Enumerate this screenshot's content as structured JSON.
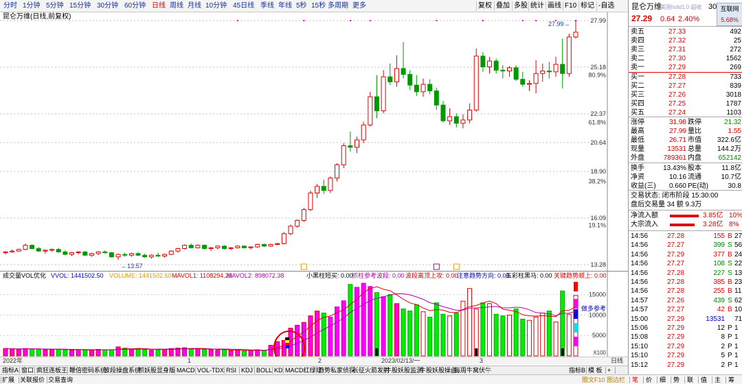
{
  "toolbar": {
    "periods": [
      "分时",
      "1分钟",
      "5分钟",
      "15分钟",
      "30分钟",
      "60分钟",
      "日线",
      "周线",
      "月线",
      "10分钟",
      "45日线",
      "季线",
      "年线",
      "5秒",
      "15秒",
      "多周期",
      "更多"
    ],
    "active": "日线",
    "right_tools": [
      "复权",
      "叠加",
      "多股",
      "统计",
      "画线",
      "F10",
      "标记",
      "-自选"
    ]
  },
  "chart_title": "昆仑万维(日线,前复权)",
  "chart_data": {
    "type": "candlestick",
    "dates_visible": [
      "2022年",
      "1",
      "2",
      "2023/02/13/一",
      "3"
    ],
    "ylim": [
      13.28,
      27.99
    ],
    "y_ticks": [
      27.99,
      25.18,
      22.37,
      20.64,
      18.9,
      16.09,
      13.28
    ],
    "y_pct_ticks": [
      {
        "price": 24.7,
        "label": "80.9%"
      },
      {
        "price": 21.85,
        "label": "61.8%"
      },
      {
        "price": 18.3,
        "label": "38.2%"
      },
      {
        "price": 15.65,
        "label": "19.1%"
      }
    ],
    "candles": [
      [
        14.0,
        14.1,
        13.9,
        14.05
      ],
      [
        14.05,
        14.2,
        14.0,
        14.1
      ],
      [
        14.1,
        14.25,
        14.05,
        14.2
      ],
      [
        14.2,
        14.55,
        14.15,
        14.45
      ],
      [
        14.45,
        14.5,
        14.2,
        14.25
      ],
      [
        14.25,
        14.35,
        14.05,
        14.1
      ],
      [
        14.1,
        14.2,
        13.95,
        14.15
      ],
      [
        14.15,
        14.25,
        14.05,
        14.2
      ],
      [
        14.2,
        14.3,
        14.0,
        14.05
      ],
      [
        14.05,
        14.15,
        13.85,
        13.9
      ],
      [
        13.9,
        14.05,
        13.8,
        14.0
      ],
      [
        14.0,
        14.1,
        13.9,
        14.05
      ],
      [
        14.05,
        14.1,
        13.8,
        13.85
      ],
      [
        13.85,
        14.0,
        13.75,
        13.95
      ],
      [
        13.95,
        14.1,
        13.85,
        14.05
      ],
      [
        14.05,
        14.15,
        13.95,
        14.0
      ],
      [
        14.0,
        14.05,
        13.7,
        13.75
      ],
      [
        13.75,
        13.95,
        13.57,
        13.9
      ],
      [
        13.9,
        14.0,
        13.75,
        13.85
      ],
      [
        13.85,
        14.0,
        13.75,
        13.95
      ],
      [
        13.95,
        14.05,
        13.8,
        13.85
      ],
      [
        13.85,
        13.95,
        13.7,
        13.75
      ],
      [
        13.75,
        13.9,
        13.65,
        13.85
      ],
      [
        13.85,
        14.0,
        13.75,
        13.8
      ],
      [
        13.8,
        13.95,
        13.7,
        13.9
      ],
      [
        13.9,
        14.15,
        13.85,
        14.1
      ],
      [
        14.1,
        14.3,
        14.0,
        14.25
      ],
      [
        14.25,
        14.5,
        14.2,
        14.45
      ],
      [
        14.45,
        14.55,
        14.25,
        14.3
      ],
      [
        14.3,
        14.5,
        14.25,
        14.45
      ],
      [
        14.45,
        14.5,
        14.2,
        14.25
      ],
      [
        14.25,
        14.35,
        14.1,
        14.3
      ],
      [
        14.3,
        14.45,
        14.2,
        14.4
      ],
      [
        14.4,
        14.45,
        14.2,
        14.25
      ],
      [
        14.25,
        14.35,
        14.15,
        14.3
      ],
      [
        14.3,
        14.45,
        14.25,
        14.4
      ],
      [
        14.4,
        14.45,
        14.25,
        14.3
      ],
      [
        14.3,
        14.4,
        14.2,
        14.35
      ],
      [
        14.35,
        14.55,
        14.3,
        14.5
      ],
      [
        14.5,
        14.55,
        14.35,
        14.4
      ],
      [
        14.4,
        14.55,
        14.35,
        14.5
      ],
      [
        14.5,
        14.6,
        14.45,
        14.55
      ],
      [
        14.55,
        15.25,
        14.5,
        15.15
      ],
      [
        15.15,
        15.7,
        15.05,
        15.6
      ],
      [
        15.6,
        16.0,
        15.5,
        15.95
      ],
      [
        15.95,
        16.7,
        15.85,
        16.6
      ],
      [
        16.6,
        17.75,
        16.5,
        17.6
      ],
      [
        17.6,
        18.15,
        17.3,
        18.0
      ],
      [
        18.0,
        18.4,
        17.55,
        17.75
      ],
      [
        17.75,
        18.6,
        17.6,
        18.5
      ],
      [
        18.5,
        19.4,
        18.3,
        19.3
      ],
      [
        19.3,
        20.6,
        19.1,
        20.45
      ],
      [
        20.45,
        21.3,
        20.1,
        20.35
      ],
      [
        20.35,
        21.0,
        20.0,
        20.8
      ],
      [
        20.8,
        21.9,
        20.6,
        21.7
      ],
      [
        21.7,
        23.7,
        21.6,
        23.4
      ],
      [
        23.4,
        24.7,
        22.1,
        22.55
      ],
      [
        22.55,
        25.0,
        22.4,
        24.6
      ],
      [
        24.6,
        25.4,
        24.1,
        24.3
      ],
      [
        24.3,
        25.9,
        24.0,
        25.1
      ],
      [
        25.1,
        26.7,
        24.5,
        24.75
      ],
      [
        24.75,
        25.0,
        23.8,
        24.1
      ],
      [
        24.1,
        24.7,
        23.45,
        23.7
      ],
      [
        23.7,
        24.5,
        23.4,
        24.15
      ],
      [
        24.15,
        24.45,
        23.55,
        23.75
      ],
      [
        23.75,
        23.95,
        22.6,
        22.9
      ],
      [
        22.9,
        23.15,
        21.85,
        21.95
      ],
      [
        21.95,
        22.7,
        21.7,
        22.2
      ],
      [
        22.2,
        22.4,
        21.55,
        21.8
      ],
      [
        21.8,
        22.35,
        21.5,
        22.0
      ],
      [
        22.0,
        23.0,
        21.8,
        22.6
      ],
      [
        22.6,
        26.3,
        22.5,
        25.85
      ],
      [
        25.85,
        26.1,
        24.9,
        25.2
      ],
      [
        25.2,
        25.8,
        24.8,
        25.55
      ],
      [
        25.55,
        25.7,
        24.8,
        25.0
      ],
      [
        25.0,
        25.3,
        24.5,
        24.95
      ],
      [
        24.95,
        25.25,
        24.6,
        25.15
      ],
      [
        25.15,
        25.3,
        24.35,
        24.45
      ],
      [
        24.45,
        24.9,
        24.0,
        24.15
      ],
      [
        24.15,
        24.4,
        23.75,
        24.2
      ],
      [
        24.2,
        25.6,
        23.6,
        24.8
      ],
      [
        24.8,
        25.4,
        24.3,
        24.95
      ],
      [
        24.95,
        25.5,
        24.5,
        24.9
      ],
      [
        24.9,
        25.8,
        24.6,
        25.35
      ],
      [
        25.35,
        26.9,
        23.9,
        24.8
      ],
      [
        24.8,
        27.2,
        24.6,
        27.0
      ],
      [
        27.0,
        27.99,
        26.9,
        27.29
      ]
    ],
    "annotations": [
      {
        "label": "13.57",
        "price": 13.57
      },
      {
        "label": "27.99",
        "price": 27.99
      }
    ],
    "volume": {
      "title": "成交量VOL优化",
      "labels": [
        {
          "text": "VVOL: 1441502.50",
          "color": "#0000cc"
        },
        {
          "text": "VOLUME: 1441502.50",
          "color": "#d4a000"
        },
        {
          "text": "MAVOL1: 1108294.25",
          "color": "#e00000"
        },
        {
          "text": "MAVOL2: 898072.38",
          "color": "#b000b0"
        },
        {
          "text": "小黑柱短买: 0.00",
          "color": "#000000"
        },
        {
          "text": "抓柱参考波段: 0.00",
          "color": "#b000b0"
        },
        {
          "text": "波段离顶上攻: 0.00",
          "color": "#e00000"
        },
        {
          "text": "注意趋势方向: 0.00",
          "color": "#0000cc"
        },
        {
          "text": "五彩柱黑马: 0.00",
          "color": "#000000"
        },
        {
          "text": "关键趋势顺上: 0.00",
          "color": "#e00000"
        }
      ],
      "y_ticks": [
        15000,
        10000,
        5000
      ],
      "ylim": [
        0,
        17800
      ],
      "unit_label": "X100",
      "tags": [
        "做多参考"
      ],
      "values": [
        1800,
        1700,
        1600,
        1800,
        1700,
        1650,
        1500,
        1550,
        1600,
        1500,
        1400,
        1500,
        1450,
        1400,
        1600,
        1500,
        1450,
        2200,
        1900,
        1700,
        1800,
        1500,
        1400,
        1500,
        1600,
        1800,
        1900,
        2000,
        1800,
        1700,
        1600,
        1500,
        1400,
        1500,
        1300,
        1400,
        1200,
        1300,
        1500,
        1300,
        2600,
        3500,
        3800,
        6800,
        7500,
        8200,
        9800,
        11000,
        10500,
        9500,
        12000,
        13500,
        17500,
        16800,
        17800,
        17000,
        15500,
        14500,
        15000,
        12800,
        11500,
        11000,
        12500,
        10800,
        9500,
        13000,
        10200,
        9800,
        10500,
        13400,
        16500,
        11500,
        13000,
        12800,
        10200,
        9800,
        10000,
        11500,
        9000,
        8700,
        9500,
        10500,
        11000,
        8300,
        15900,
        10200,
        14800
      ]
    }
  },
  "stock": {
    "name": "昆仑万维",
    "name_tail": "美国hold1.0 超收",
    "code": "300418",
    "code_short": "300",
    "tag": "互联网",
    "price": "27.29",
    "change": "0.64",
    "pct": "2.40%",
    "weibi": "5.68%"
  },
  "orderbook": {
    "asks": [
      {
        "label": "卖五",
        "price": "27.33",
        "vol": "492"
      },
      {
        "label": "卖四",
        "price": "27.32",
        "vol": "25"
      },
      {
        "label": "卖三",
        "price": "27.31",
        "vol": "272"
      },
      {
        "label": "卖二",
        "price": "27.30",
        "vol": "1562"
      },
      {
        "label": "卖一",
        "price": "27.29",
        "vol": "269"
      }
    ],
    "bids": [
      {
        "label": "买一",
        "price": "27.28",
        "vol": "733"
      },
      {
        "label": "买二",
        "price": "27.27",
        "vol": "839"
      },
      {
        "label": "买三",
        "price": "27.26",
        "vol": "3018"
      },
      {
        "label": "买四",
        "price": "27.25",
        "vol": "1787"
      },
      {
        "label": "买五",
        "price": "27.24",
        "vol": "1103"
      }
    ]
  },
  "stats": [
    {
      "l1": "涨停",
      "v1": "31.98",
      "c1": "red",
      "l2": "跌停",
      "v2": "21.32",
      "c2": "green"
    },
    {
      "l1": "最高",
      "v1": "27.99",
      "c1": "red",
      "l2": "量比",
      "v2": "1.55",
      "c2": "red"
    },
    {
      "l1": "最低",
      "v1": "26.71",
      "c1": "red",
      "l2": "市值",
      "v2": "322.6亿",
      "c2": "dark"
    },
    {
      "l1": "现量",
      "v1": "13531",
      "c1": "red",
      "l2": "总量",
      "v2": "144.2万",
      "c2": "dark"
    },
    {
      "l1": "外盘",
      "v1": "789361",
      "c1": "red",
      "l2": "内盘",
      "v2": "652142",
      "c2": "green"
    }
  ],
  "stats2": [
    {
      "l1": "换手",
      "v1": "13.43%",
      "c1": "dark",
      "l2": "股本",
      "v2": "11.8亿",
      "c2": "dark"
    },
    {
      "l1": "净资",
      "v1": "10.16",
      "c1": "dark",
      "l2": "流通",
      "v2": "10.7亿",
      "c2": "dark"
    },
    {
      "l1": "收益(三)",
      "v1": "0.660",
      "c1": "dark",
      "l2": "PE(动)",
      "v2": "30.8",
      "c2": "dark"
    }
  ],
  "trade_status": "交易状态: 闭市阶段 15:30:00",
  "after_hours": "盘后交易量 34 额 9.3万",
  "flows": [
    {
      "label": "净流入额",
      "value": "3.85亿",
      "pct": "10%"
    },
    {
      "label": "大宗流入",
      "value": "3.28亿",
      "pct": "8%"
    }
  ],
  "ticks": [
    {
      "time": "14:56",
      "price": "27.28",
      "vol": "155",
      "bs": "B",
      "n": "27"
    },
    {
      "time": "14:56",
      "price": "27.27",
      "vol": "399",
      "bs": "S",
      "n": "56"
    },
    {
      "time": "14:56",
      "price": "27.29",
      "vol": "377",
      "bs": "B",
      "n": "24"
    },
    {
      "time": "14:56",
      "price": "27.27",
      "vol": "108",
      "bs": "S",
      "n": "22"
    },
    {
      "time": "14:56",
      "price": "27.28",
      "vol": "227",
      "bs": "S",
      "n": "13"
    },
    {
      "time": "14:56",
      "price": "27.28",
      "vol": "385",
      "bs": "B",
      "n": "23"
    },
    {
      "time": "14:56",
      "price": "27.28",
      "vol": "255",
      "bs": "B",
      "n": "11"
    },
    {
      "time": "14:57",
      "price": "27.26",
      "vol": "439",
      "bs": "S",
      "n": "62"
    },
    {
      "time": "14:57",
      "price": "27.27",
      "vol": "42",
      "bs": "B",
      "n": "10"
    },
    {
      "time": "15:00",
      "price": "27.29",
      "vol": "13531",
      "bs": "",
      "n": "719"
    },
    {
      "time": "15:06",
      "price": "27.29",
      "vol": "12",
      "bs": "P",
      "n": "1"
    },
    {
      "time": "15:08",
      "price": "27.29",
      "vol": "8",
      "bs": "P",
      "n": "1"
    },
    {
      "time": "15:10",
      "price": "27.29",
      "vol": "2",
      "bs": "P",
      "n": "1"
    },
    {
      "time": "15:10",
      "price": "27.29",
      "vol": "5",
      "bs": "P",
      "n": "1"
    },
    {
      "time": "15:12",
      "price": "27.29",
      "vol": "2",
      "bs": "P",
      "n": "1"
    }
  ],
  "indicator_tabs": [
    "指标A",
    "窗口",
    "疯狂连板王",
    "鞭倍密码系统",
    "波段操盘系统",
    "抓妖股显身版",
    "MACD",
    "VOL-TDX",
    "RSI",
    "KDJ",
    "BOLL",
    "KD",
    "MACD红绿灯",
    "趋势私家侦探",
    "长征火箭发射",
    "牛股妖股监测",
    "牛股妖股操盘",
    "每周牛窝伏牛",
    "指标B",
    "模 板",
    "+"
  ],
  "bottom_tabs": [
    "扩展",
    "关联报价",
    "交易查询"
  ],
  "panel_bottom_tabs": [
    "笔",
    "价",
    "细",
    "势",
    "联",
    "值",
    "主",
    "筹"
  ],
  "panel_bottom_label": "圈文F10 图边栏"
}
